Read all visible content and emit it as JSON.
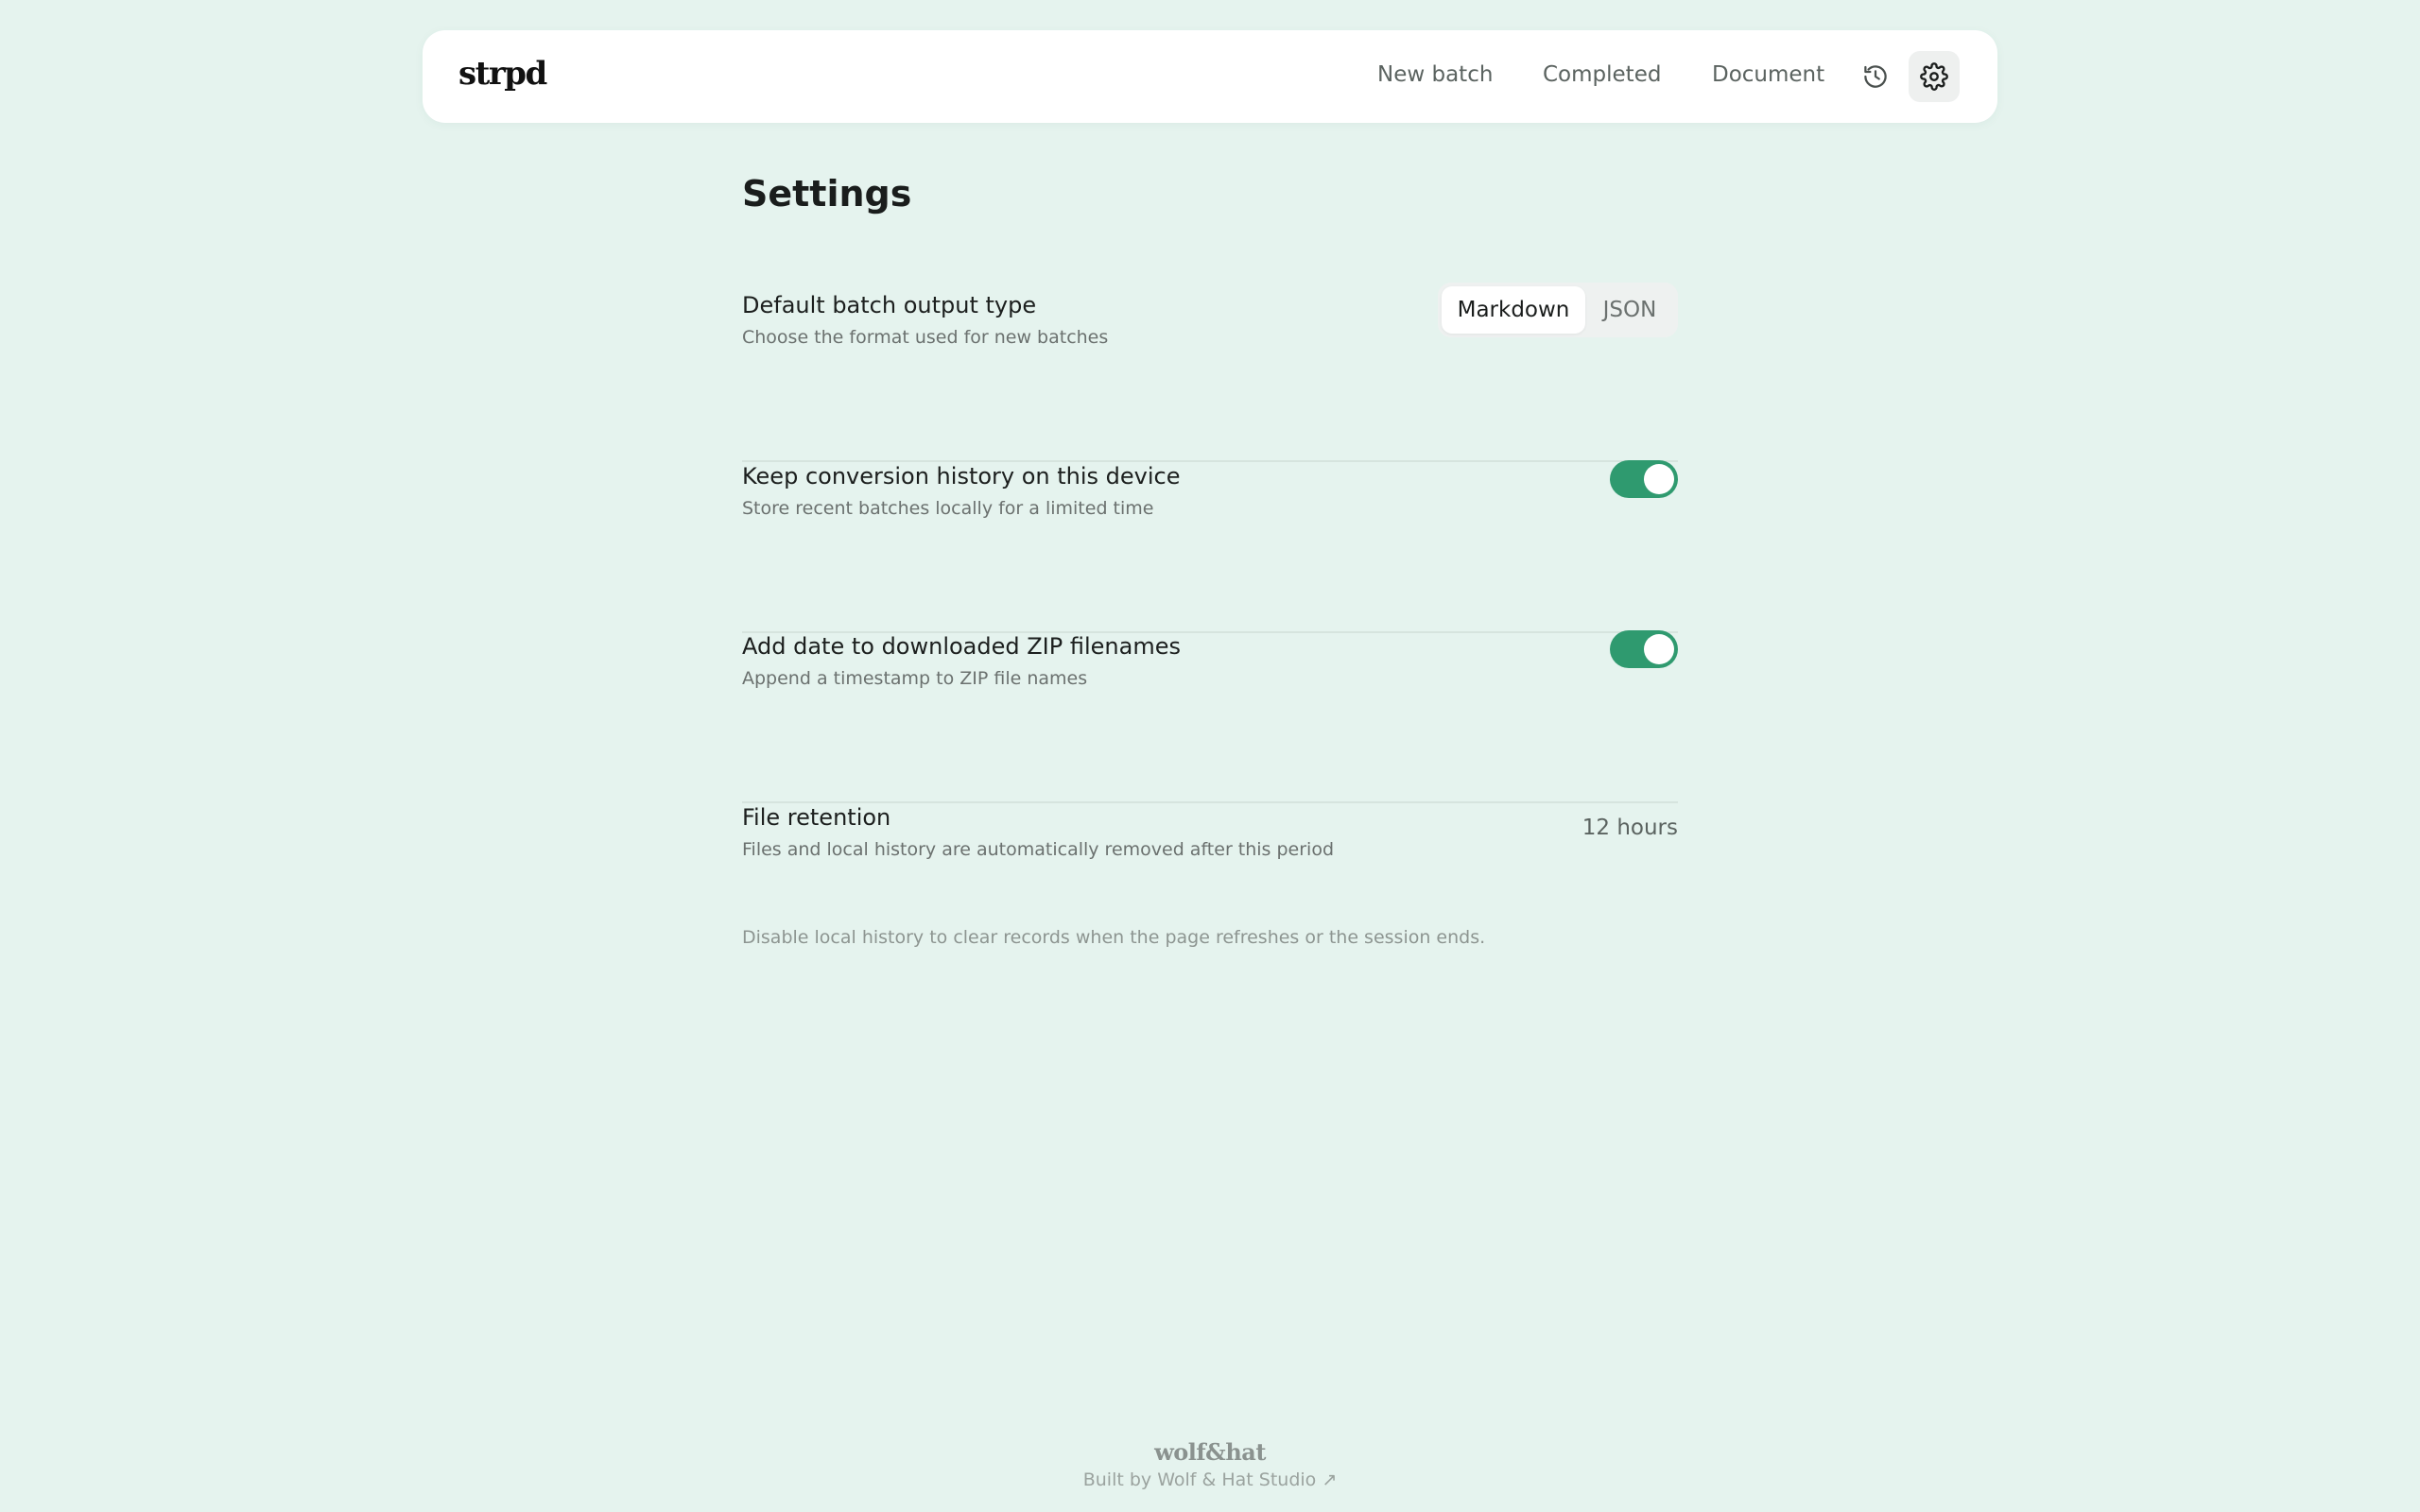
{
  "header": {
    "logo": "strpd",
    "nav": [
      {
        "label": "New batch"
      },
      {
        "label": "Completed"
      },
      {
        "label": "Document"
      }
    ],
    "icons": [
      "history-icon",
      "gear-icon"
    ]
  },
  "page": {
    "title": "Settings"
  },
  "settings": [
    {
      "title": "Default batch output type",
      "description": "Choose the format used for new batches",
      "control": "segmented",
      "options": [
        "Markdown",
        "JSON"
      ],
      "selected": "Markdown"
    },
    {
      "title": "Keep conversion history on this device",
      "description": "Store recent batches locally for a limited time",
      "control": "toggle",
      "on": true
    },
    {
      "title": "Add date to downloaded ZIP filenames",
      "description": "Append a timestamp to ZIP file names",
      "control": "toggle",
      "on": true
    },
    {
      "title": "File retention",
      "description": "Files and local history are automatically removed after this period",
      "control": "value",
      "value": "12 hours"
    }
  ],
  "footnote": "Disable local history to clear records when the page refreshes or the session ends.",
  "footer": {
    "logo": "wolf&hat",
    "link": "Built by Wolf & Hat Studio ↗"
  },
  "colors": {
    "background": "#e5f3ee",
    "accent": "#2f9a6f",
    "card": "#ffffff"
  }
}
